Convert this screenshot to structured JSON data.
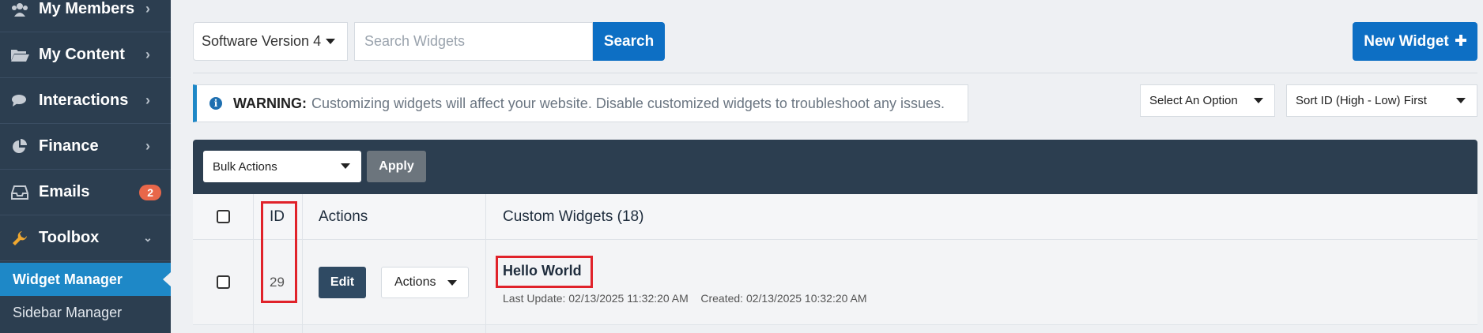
{
  "sidebar": {
    "items": [
      {
        "label": "My Members",
        "icon": "users-icon"
      },
      {
        "label": "My Content",
        "icon": "folder-open-icon"
      },
      {
        "label": "Interactions",
        "icon": "comments-icon"
      },
      {
        "label": "Finance",
        "icon": "pie-chart-icon"
      },
      {
        "label": "Emails",
        "icon": "inbox-icon",
        "badge": "2"
      },
      {
        "label": "Toolbox",
        "icon": "wrench-icon",
        "expanded": true
      }
    ],
    "subitems": [
      {
        "label": "Widget Manager",
        "active": true
      },
      {
        "label": "Sidebar Manager",
        "active": false
      }
    ]
  },
  "toolbar": {
    "version_select": "Software Version 4",
    "search_placeholder": "Search Widgets",
    "search_label": "Search",
    "new_widget_label": "New Widget"
  },
  "warning": {
    "label": "WARNING:",
    "text": "Customizing widgets will affect your website. Disable customized widgets to troubleshoot any issues."
  },
  "filters": {
    "option_select": "Select An Option",
    "sort_select": "Sort ID (High - Low) First"
  },
  "table": {
    "bulk_actions": "Bulk Actions",
    "apply_label": "Apply",
    "headers": {
      "id": "ID",
      "actions": "Actions",
      "widgets": "Custom Widgets (18)"
    },
    "rows": [
      {
        "id": "29",
        "edit_label": "Edit",
        "actions_label": "Actions",
        "title": "Hello World",
        "meta": "Last Update: 02/13/2025 11:32:20 AM    Created: 02/13/2025 10:32:20 AM"
      }
    ]
  },
  "colors": {
    "sidebar_bg": "#2c3e50",
    "accent": "#0d6fc4",
    "active_nav": "#1e88c7",
    "highlight": "#e0222a",
    "badge": "#e8674a"
  }
}
